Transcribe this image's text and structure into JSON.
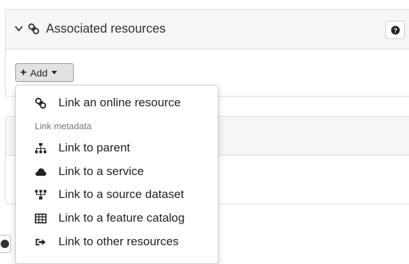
{
  "panel": {
    "title": "Associated resources",
    "add_label": "Add"
  },
  "menu": {
    "first": {
      "label": "Link an online resource",
      "icon": "link-icon"
    },
    "header": "Link metadata",
    "items": [
      {
        "label": "Link to parent",
        "icon": "sitemap-icon"
      },
      {
        "label": "Link to a service",
        "icon": "cloud-icon"
      },
      {
        "label": "Link to a source dataset",
        "icon": "source-tree-icon"
      },
      {
        "label": "Link to a feature catalog",
        "icon": "table-icon"
      },
      {
        "label": "Link to other resources",
        "icon": "share-icon"
      }
    ]
  }
}
